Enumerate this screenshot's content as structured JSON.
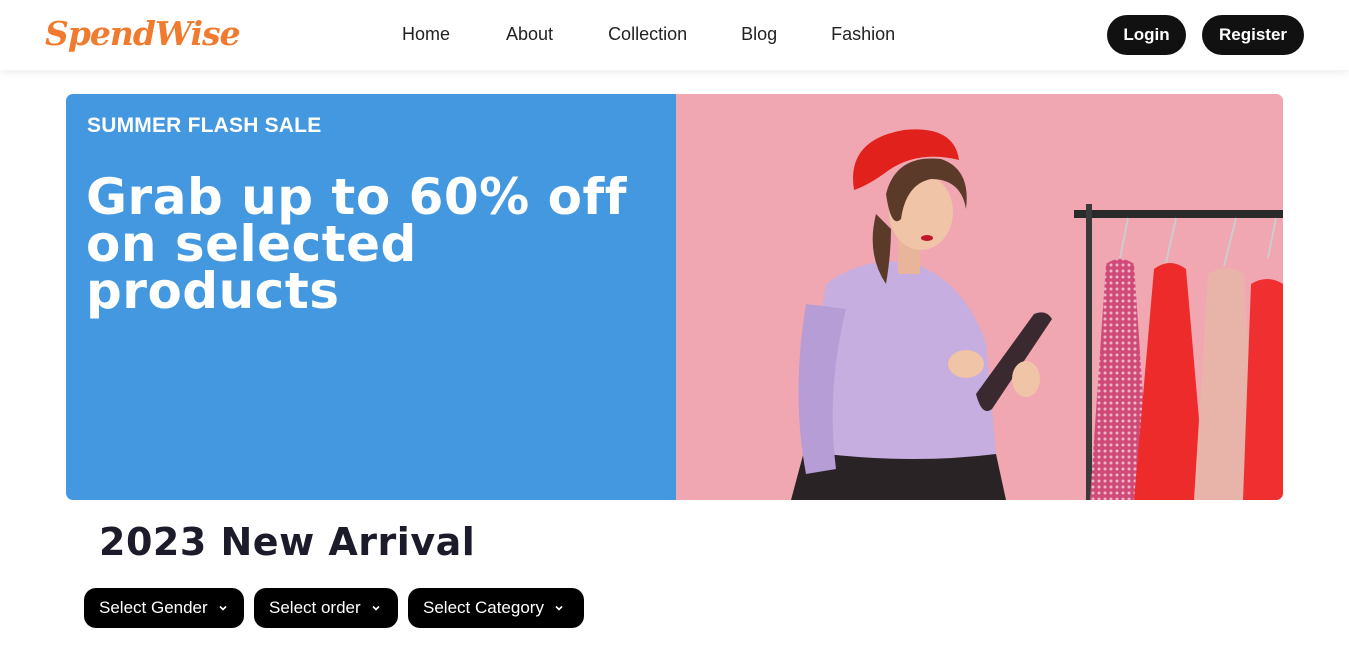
{
  "header": {
    "logo": "SpendWise",
    "nav": [
      "Home",
      "About",
      "Collection",
      "Blog",
      "Fashion"
    ],
    "login_label": "Login",
    "register_label": "Register"
  },
  "hero": {
    "eyebrow": "SUMMER FLASH SALE",
    "headline": "Grab up to 60% off on selected products",
    "image_icon": "fashion-model-photo"
  },
  "section": {
    "title": "2023 New Arrival"
  },
  "filters": {
    "gender": "Select Gender",
    "order": "Select order",
    "category": "Select Category"
  },
  "colors": {
    "brand": "#f07a2e",
    "hero_blue": "#4398e0",
    "hero_pink": "#f0a7b1",
    "button_dark": "#111111"
  }
}
